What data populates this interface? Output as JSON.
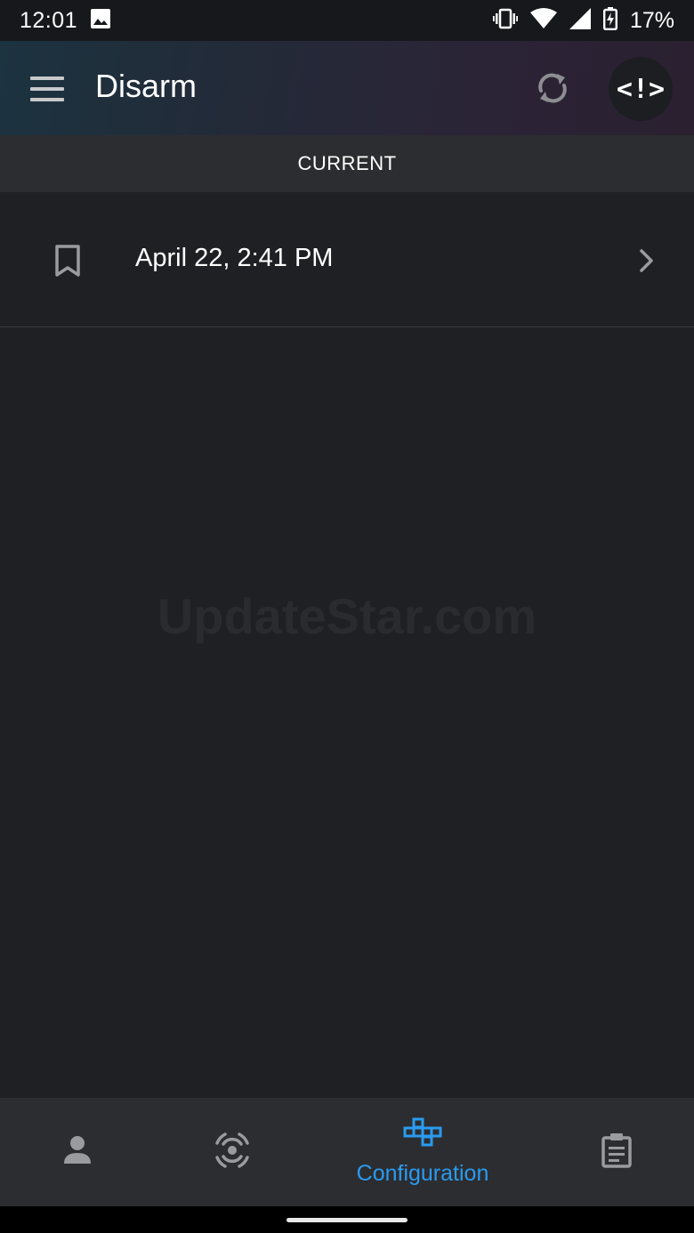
{
  "status_bar": {
    "time": "12:01",
    "battery_percent": "17%",
    "icons": [
      "image-icon",
      "vibrate-icon",
      "wifi-icon",
      "signal-icon",
      "battery-charging-icon"
    ]
  },
  "app_bar": {
    "title": "Disarm",
    "code_button_label": "<!>",
    "icons": [
      "menu-icon",
      "sync-icon"
    ]
  },
  "tabs": [
    {
      "label": "CURRENT",
      "selected": true
    }
  ],
  "list": {
    "items": [
      {
        "label": "April 22, 2:41 PM",
        "icon": "bookmark-icon",
        "trailing_icon": "chevron-right-icon"
      }
    ]
  },
  "watermark": "UpdateStar.com",
  "bottom_nav": {
    "items": [
      {
        "icon": "person-icon",
        "label": ""
      },
      {
        "icon": "target-icon",
        "label": ""
      },
      {
        "icon": "configuration-icon",
        "label": "Configuration",
        "selected": true
      },
      {
        "icon": "clipboard-icon",
        "label": ""
      }
    ]
  },
  "colors": {
    "accent": "#2a9bf0",
    "background": "#1f2024",
    "surface": "#2c2d30",
    "icon_gray": "#9a9b9f"
  }
}
